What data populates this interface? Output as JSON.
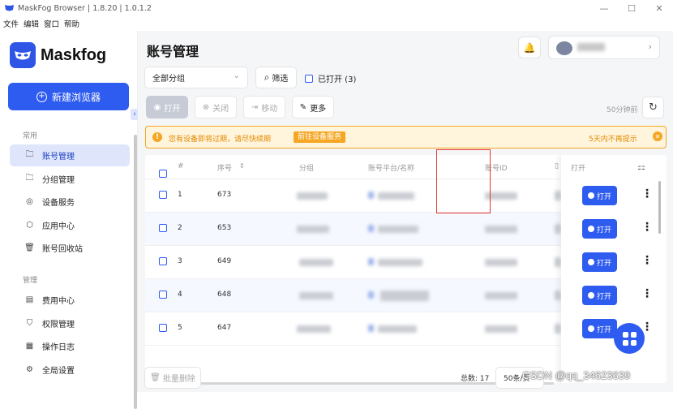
{
  "window": {
    "title": "MaskFog Browser | 1.8.20 | 1.0.1.2"
  },
  "menu": [
    "文件",
    "编辑",
    "窗口",
    "帮助"
  ],
  "sidebar": {
    "brand": "Maskfog",
    "new_button": "新建浏览器",
    "section_common": "常用",
    "common_items": [
      {
        "label": "账号管理",
        "icon": "folder-icon"
      },
      {
        "label": "分组管理",
        "icon": "folder-icon"
      },
      {
        "label": "设备服务",
        "icon": "location-icon"
      },
      {
        "label": "应用中心",
        "icon": "box-icon"
      },
      {
        "label": "账号回收站",
        "icon": "trash-icon"
      }
    ],
    "section_manage": "管理",
    "manage_items": [
      {
        "label": "费用中心",
        "icon": "receipt-icon"
      },
      {
        "label": "权限管理",
        "icon": "shield-icon"
      },
      {
        "label": "操作日志",
        "icon": "log-icon"
      },
      {
        "label": "全局设置",
        "icon": "gear-icon"
      }
    ]
  },
  "header": {
    "title": "账号管理"
  },
  "toolbar": {
    "group_select": "全部分组",
    "filter": "筛选",
    "opened_label": "已打开 (3)",
    "open": "打开",
    "close": "关闭",
    "move": "移动",
    "more": "更多",
    "sync": "50分钟前"
  },
  "banner": {
    "message": "您有设备即将过期，请尽快续期",
    "goto": "前往设备服务",
    "dismiss": "5天内不再提示"
  },
  "table": {
    "columns": [
      "#",
      "序号",
      "分组",
      "账号平台/名称",
      "账号ID",
      "打开"
    ],
    "rows": [
      {
        "index": "1",
        "seq": "673",
        "action": "打开"
      },
      {
        "index": "2",
        "seq": "653",
        "action": "打开"
      },
      {
        "index": "3",
        "seq": "649",
        "action": "打开"
      },
      {
        "index": "4",
        "seq": "648",
        "action": "打开"
      },
      {
        "index": "5",
        "seq": "647",
        "action": "打开"
      }
    ]
  },
  "footer": {
    "bulk_delete": "批量删除",
    "total": "总数: 17",
    "per_page": "50条/页"
  },
  "watermark": "CSDN @qq_34623639",
  "colors": {
    "accent": "#2f5cf0",
    "warning": "#f5a623",
    "highlight": "#e53935"
  }
}
